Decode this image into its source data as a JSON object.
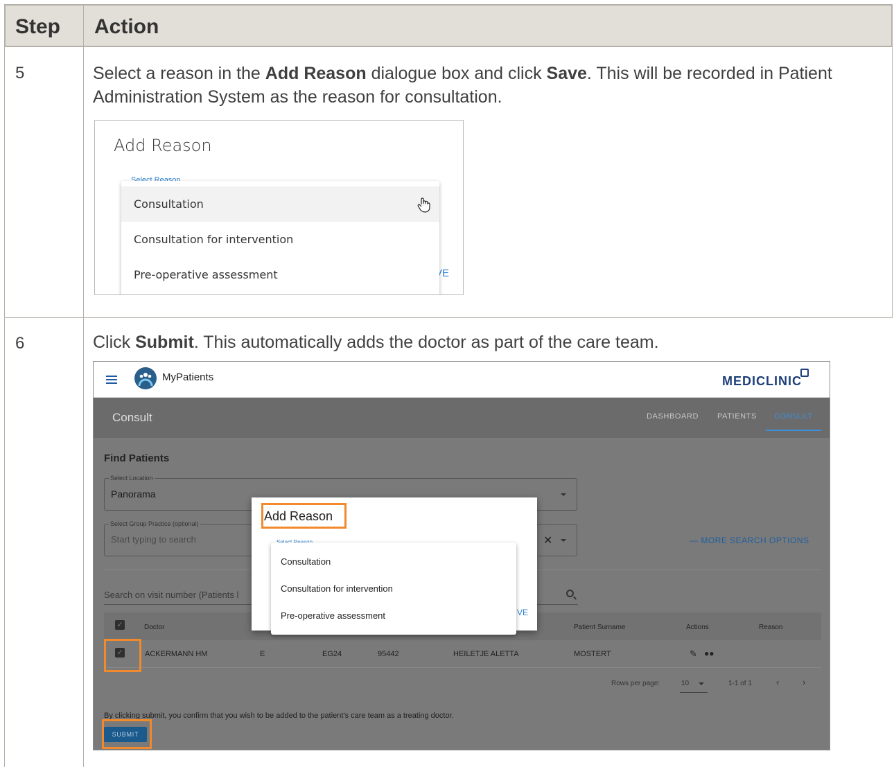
{
  "table": {
    "header": {
      "step": "Step",
      "action": "Action"
    },
    "rows": [
      {
        "step": "5",
        "text_parts": [
          "Select a reason in the ",
          "Add Reason",
          " dialogue box and click ",
          "Save",
          ".  This will be recorded in Patient Administration System as the reason for consultation."
        ]
      },
      {
        "step": "6",
        "text_parts": [
          "Click ",
          "Submit",
          ".  This automatically adds the doctor as part of the care team."
        ]
      }
    ]
  },
  "step5_dialog": {
    "title": "Add Reason",
    "select_label": "Select Reason",
    "options": [
      "Consultation",
      "Consultation for intervention",
      "Pre-operative assessment"
    ],
    "highlighted_option": "Consultation",
    "save_partial": "VE",
    "cursor": "hand-pointer-icon"
  },
  "step6_screen": {
    "app_name": "MyPatients",
    "brand": "MEDICLINIC",
    "page_title": "Consult",
    "tabs": [
      "DASHBOARD",
      "PATIENTS",
      "CONSULT"
    ],
    "active_tab": "CONSULT",
    "find_heading": "Find Patients",
    "location": {
      "label": "Select Location",
      "value": "Panorama"
    },
    "group_practice": {
      "label": "Select Group Practice (optional)",
      "placeholder": "Start typing to search"
    },
    "more_options": "— MORE SEARCH OPTIONS",
    "search_placeholder": "Search on visit number (Patients l",
    "columns": [
      "Doctor",
      "Patient Surname",
      "Actions",
      "Reason"
    ],
    "row": {
      "doctor": "ACKERMANN HM",
      "col2": "E",
      "col3": "EG24",
      "visit": "95442",
      "first_name": "HEILETJE ALETTA",
      "surname": "MOSTERT"
    },
    "pager": {
      "rows_label": "Rows per page:",
      "rows_value": "10",
      "range": "1-1 of 1"
    },
    "confirm_text": "By clicking submit, you confirm that you wish to be added to the patient's care team as a treating doctor.",
    "submit_label": "SUBMIT",
    "dialog": {
      "title": "Add Reason",
      "select_label": "Select Reason",
      "options": [
        "Consultation",
        "Consultation for intervention",
        "Pre-operative assessment"
      ],
      "save_partial": "VE"
    },
    "highlight_color": "#f08a2c"
  }
}
